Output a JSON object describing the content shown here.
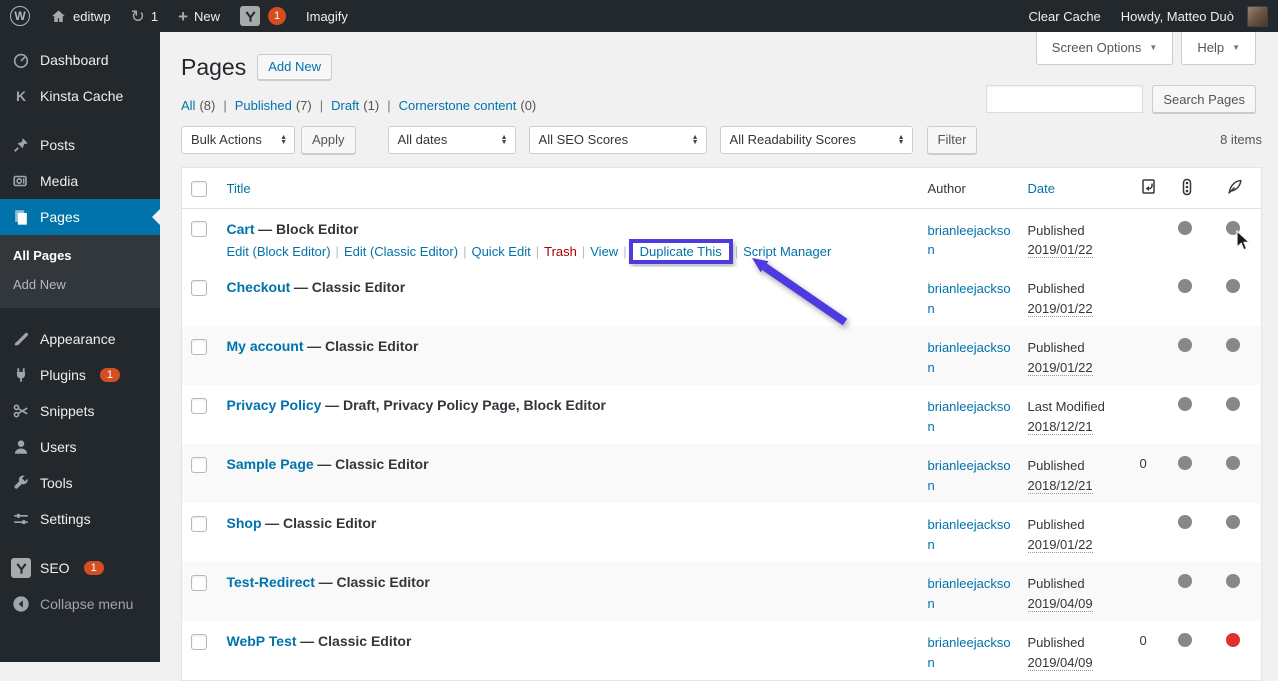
{
  "colors": {
    "accent_blue": "#0073aa",
    "admin_dark": "#23282d",
    "badge_red": "#d54e21",
    "annotation_purple": "#4e3be0",
    "dot_gray": "#888888",
    "dot_red": "#dc3232"
  },
  "admin_bar": {
    "left": [
      {
        "name": "wordpress-logo",
        "icon": "wordpress"
      },
      {
        "name": "site-name",
        "icon": "home",
        "label": "editwp"
      },
      {
        "name": "updates",
        "icon": "update",
        "label": "1"
      },
      {
        "name": "new-content",
        "icon": "plus",
        "label": "New"
      },
      {
        "name": "seo-notifications",
        "icon": "yoast",
        "badge": "1"
      },
      {
        "name": "imagify",
        "label": "Imagify"
      }
    ],
    "right": [
      {
        "name": "clear-cache",
        "label": "Clear Cache"
      },
      {
        "name": "my-account",
        "label": "Howdy, Matteo Duò",
        "avatar": true
      }
    ]
  },
  "sidebar": {
    "items": [
      {
        "id": "dashboard",
        "label": "Dashboard",
        "icon": "dashboard"
      },
      {
        "id": "kinsta-cache",
        "label": "Kinsta Cache",
        "icon": "kinsta",
        "gap_after": true
      },
      {
        "id": "posts",
        "label": "Posts",
        "icon": "posts"
      },
      {
        "id": "media",
        "label": "Media",
        "icon": "media"
      },
      {
        "id": "pages",
        "label": "Pages",
        "icon": "pages",
        "active": true,
        "submenu": [
          {
            "label": "All Pages",
            "current": true
          },
          {
            "label": "Add New"
          }
        ],
        "gap_after": true
      },
      {
        "id": "appearance",
        "label": "Appearance",
        "icon": "appearance"
      },
      {
        "id": "plugins",
        "label": "Plugins",
        "icon": "plugins",
        "badge": "1"
      },
      {
        "id": "snippets",
        "label": "Snippets",
        "icon": "snippets"
      },
      {
        "id": "users",
        "label": "Users",
        "icon": "users"
      },
      {
        "id": "tools",
        "label": "Tools",
        "icon": "tools"
      },
      {
        "id": "settings",
        "label": "Settings",
        "icon": "settings",
        "gap_after": true
      },
      {
        "id": "seo",
        "label": "SEO",
        "icon": "yoast",
        "badge": "1"
      },
      {
        "id": "collapse",
        "label": "Collapse menu",
        "icon": "collapse",
        "muted": true
      }
    ]
  },
  "page": {
    "title": "Pages",
    "add_new": "Add New",
    "screen_options": "Screen Options",
    "help": "Help",
    "search": {
      "value": "",
      "button": "Search Pages"
    },
    "views": [
      {
        "label": "All",
        "count": "(8)"
      },
      {
        "label": "Published",
        "count": "(7)"
      },
      {
        "label": "Draft",
        "count": "(1)"
      },
      {
        "label": "Cornerstone content",
        "count": "(0)"
      }
    ],
    "toolbar": {
      "bulk_actions": "Bulk Actions",
      "apply": "Apply",
      "dates": "All dates",
      "seo_scores": "All SEO Scores",
      "readability_scores": "All Readability Scores",
      "filter": "Filter",
      "item_count": "8 items"
    },
    "table": {
      "columns": {
        "title": "Title",
        "author": "Author",
        "date": "Date"
      },
      "icon_columns": [
        "incoming-links",
        "seo-score",
        "readability-score"
      ],
      "rows": [
        {
          "title": "Cart",
          "state": "— Block Editor",
          "author": "brianleejackson",
          "date_status": "Published",
          "date": "2019/01/22",
          "links": "",
          "seo": "gray",
          "readability": "gray",
          "actions": [
            {
              "label": "Edit (Block Editor)"
            },
            {
              "label": "Edit (Classic Editor)"
            },
            {
              "label": "Quick Edit"
            },
            {
              "label": "Trash",
              "style": "trash"
            },
            {
              "label": "View"
            },
            {
              "label": "Duplicate This",
              "highlighted": true
            },
            {
              "label": "Script Manager"
            }
          ]
        },
        {
          "title": "Checkout",
          "state": "— Classic Editor",
          "author": "brianleejackson",
          "date_status": "Published",
          "date": "2019/01/22",
          "links": "",
          "seo": "gray",
          "readability": "gray"
        },
        {
          "title": "My account",
          "state": "— Classic Editor",
          "author": "brianleejackson",
          "date_status": "Published",
          "date": "2019/01/22",
          "links": "",
          "seo": "gray",
          "readability": "gray"
        },
        {
          "title": "Privacy Policy",
          "state": "— Draft, Privacy Policy Page, Block Editor",
          "author": "brianleejackson",
          "date_status": "Last Modified",
          "date": "2018/12/21",
          "links": "",
          "seo": "gray",
          "readability": "gray"
        },
        {
          "title": "Sample Page",
          "state": "— Classic Editor",
          "author": "brianleejackson",
          "date_status": "Published",
          "date": "2018/12/21",
          "links": "0",
          "seo": "gray",
          "readability": "gray"
        },
        {
          "title": "Shop",
          "state": "— Classic Editor",
          "author": "brianleejackson",
          "date_status": "Published",
          "date": "2019/01/22",
          "links": "",
          "seo": "gray",
          "readability": "gray"
        },
        {
          "title": "Test-Redirect",
          "state": "— Classic Editor",
          "author": "brianleejackson",
          "date_status": "Published",
          "date": "2019/04/09",
          "links": "",
          "seo": "gray",
          "readability": "gray"
        },
        {
          "title": "WebP Test",
          "state": "— Classic Editor",
          "author": "brianleejackson",
          "date_status": "Published",
          "date": "2019/04/09",
          "links": "0",
          "seo": "gray",
          "readability": "red"
        }
      ]
    }
  }
}
